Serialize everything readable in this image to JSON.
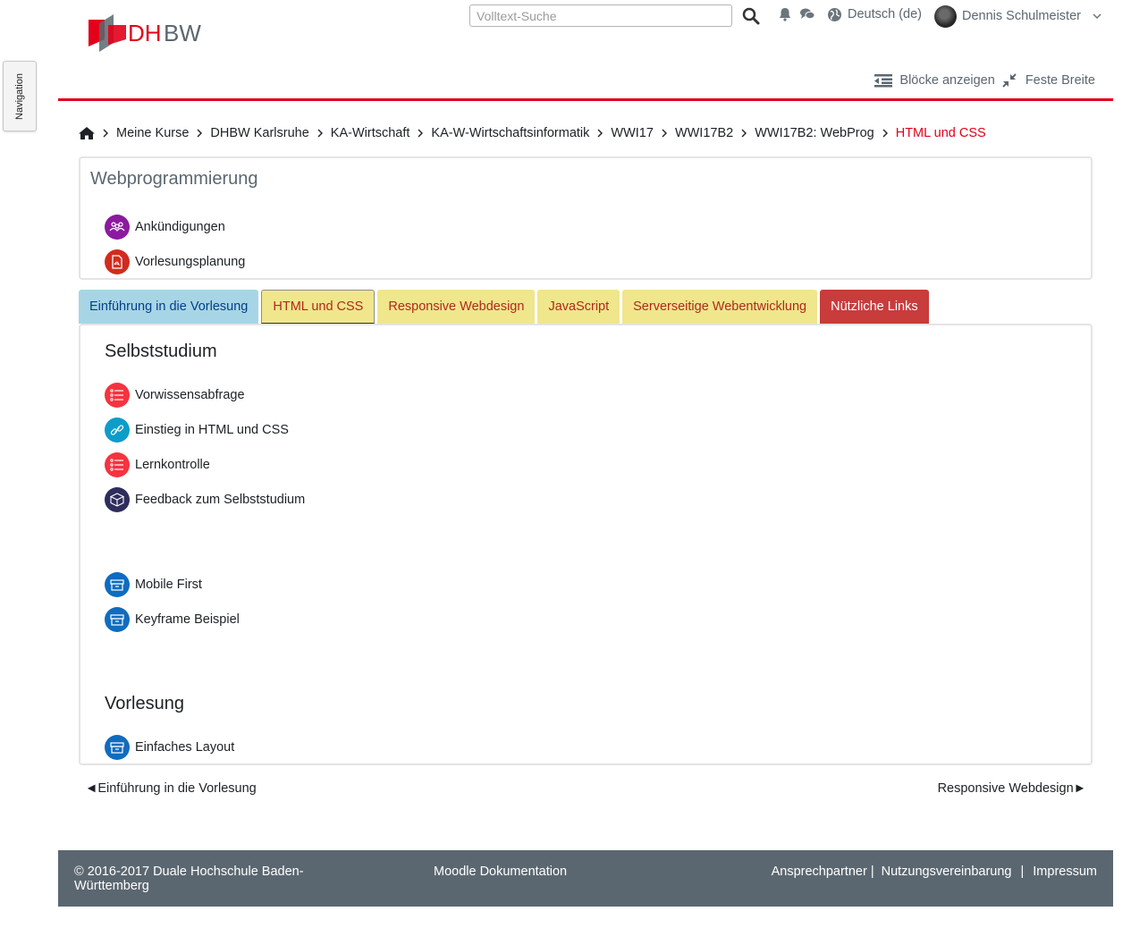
{
  "nav": {
    "label": "Navigation"
  },
  "header": {
    "logo_text": "DHBW",
    "search_placeholder": "Volltext-Suche",
    "language": "Deutsch (de)",
    "user_name": "Dennis Schulmeister",
    "blocks_label": "Blöcke anzeigen",
    "width_label": "Feste Breite",
    "accent_color": "#e2001a"
  },
  "breadcrumb": [
    "Meine Kurse",
    "DHBW Karlsruhe",
    "KA-Wirtschaft",
    "KA-W-Wirtschaftsinformatik",
    "WWI17",
    "WWI17B2",
    "WWI17B2: WebProg",
    "HTML und CSS"
  ],
  "course": {
    "title": "Webprogrammierung",
    "activities": [
      {
        "label": "Ankündigungen",
        "icon": "forum-icon",
        "color": "#8b1a9e"
      },
      {
        "label": "Vorlesungsplanung",
        "icon": "pdf-icon",
        "color": "#d12b1e"
      }
    ]
  },
  "tabs": [
    {
      "label": "Einführung in die Vorlesung",
      "style": "blue"
    },
    {
      "label": "HTML und CSS",
      "style": "yellow",
      "active": true
    },
    {
      "label": "Responsive Webdesign",
      "style": "yellow"
    },
    {
      "label": "JavaScript",
      "style": "yellow"
    },
    {
      "label": "Serverseitige Webentwicklung",
      "style": "yellow"
    },
    {
      "label": "Nützliche Links",
      "style": "red"
    }
  ],
  "section": {
    "title1": "Selbststudium",
    "items1": [
      {
        "label": "Vorwissensabfrage",
        "icon": "quiz-icon",
        "color": "#f5333f"
      },
      {
        "label": "Einstieg in HTML und CSS",
        "icon": "link-icon",
        "color": "#0e9cc9"
      },
      {
        "label": "Lernkontrolle",
        "icon": "quiz-icon",
        "color": "#f5333f"
      },
      {
        "label": "Feedback zum Selbststudium",
        "icon": "feedback-icon",
        "color": "#2e2d5c"
      }
    ],
    "items2": [
      {
        "label": "Mobile First",
        "icon": "folder-icon",
        "color": "#0f6cbf"
      },
      {
        "label": "Keyframe Beispiel",
        "icon": "folder-icon",
        "color": "#0f6cbf"
      }
    ],
    "title2": "Vorlesung",
    "items3": [
      {
        "label": "Einfaches Layout",
        "icon": "folder-icon",
        "color": "#0f6cbf"
      }
    ]
  },
  "pagenav": {
    "prev": "◄Einführung in die Vorlesung",
    "next": "Responsive Webdesign►"
  },
  "footer": {
    "copyright": "© 2016-2017 Duale Hochschule Baden-Württemberg",
    "docs": "Moodle Dokumentation",
    "contact": "Ansprechpartner |",
    "terms": "Nutzungsvereinbarung",
    "sep": "|",
    "imprint": "Impressum"
  }
}
